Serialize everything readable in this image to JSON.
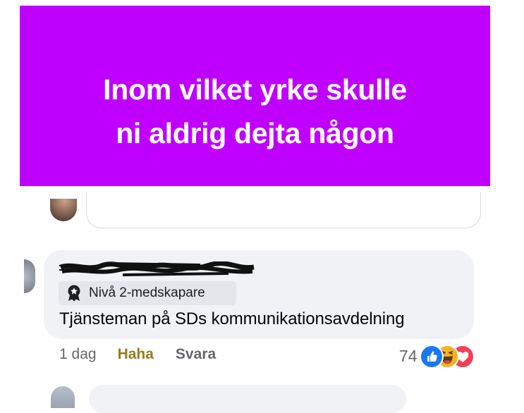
{
  "post": {
    "line1": "Inom vilket yrke skulle",
    "line2": "ni aldrig dejta någon",
    "background_color": "#bf00ff"
  },
  "comment": {
    "badge_icon": "top-fan-badge-icon",
    "badge_label": "Nivå 2-medskapare",
    "text": "Tjänsteman på SDs kommunikationsavdelning"
  },
  "actions": {
    "time": "1 dag",
    "reaction_label": "Haha",
    "reply_label": "Svara"
  },
  "reactions": {
    "count": "74",
    "icons": [
      "like-icon",
      "haha-icon",
      "love-icon"
    ]
  }
}
